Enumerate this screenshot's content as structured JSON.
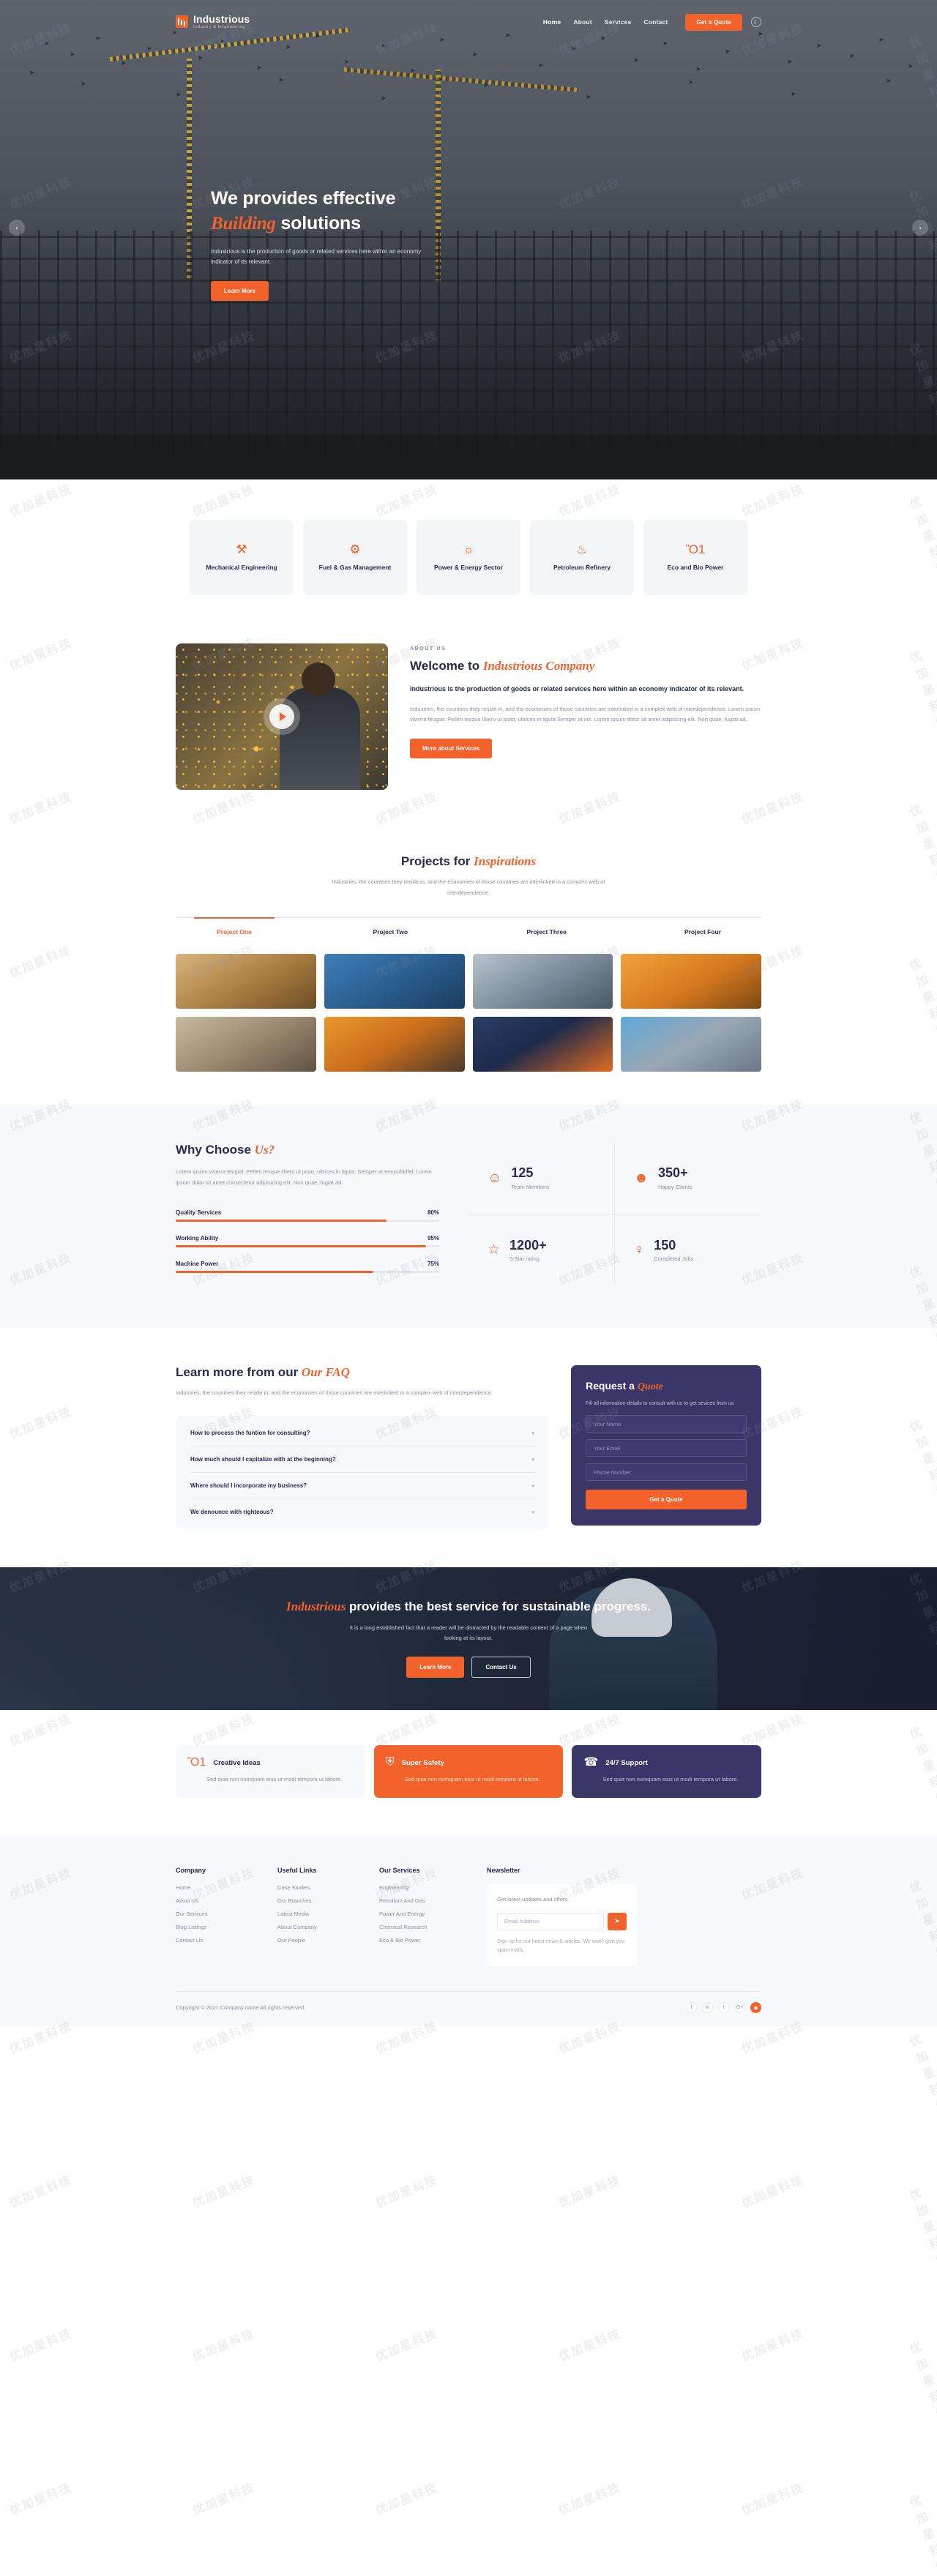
{
  "header": {
    "brand_name": "Industrious",
    "brand_sub": "Industry & Engineering",
    "nav": [
      {
        "label": "Home",
        "active": true
      },
      {
        "label": "About",
        "active": false
      },
      {
        "label": "Services",
        "active": false
      },
      {
        "label": "Contact",
        "active": false
      }
    ],
    "quote_label": "Get a Quote",
    "theme_icon": "moon-icon"
  },
  "hero": {
    "title_line1": "We provides effective",
    "title_em": "Building",
    "title_line2": " solutions",
    "paragraph": "Industrious is the production of goods or related services here within an economy indicator of its relevant.",
    "button": "Learn More",
    "prev_icon": "chevron-left-icon",
    "next_icon": "chevron-right-icon"
  },
  "services": [
    {
      "icon": "wrench-icon",
      "glyph": "⚒",
      "label": "Mechanical Engineering"
    },
    {
      "icon": "gears-icon",
      "glyph": "⚙",
      "label": "Fuel & Gas Management"
    },
    {
      "icon": "sun-energy-icon",
      "glyph": "☼",
      "label": "Power & Energy Sector"
    },
    {
      "icon": "flame-icon",
      "glyph": "♨",
      "label": "Petroleum Refinery"
    },
    {
      "icon": "bulb-icon",
      "glyph": "Ὂ1",
      "label": "Eco and Bio Power"
    }
  ],
  "about": {
    "eyebrow": "ABOUT US",
    "heading_plain": "Welcome to ",
    "heading_em": "Industrious Company",
    "lead": "Industrious is the production of goods or related services here within an economy indicator of its relevant.",
    "body": "Industries, the countries they reside in, and the economies of those countries are interlinked in a complex web of interdependence. Lorem ipsum viverra feugiat. Pellen tesque libero ut justo, ultrices in ligula Semper at init. Lorem ipsum dolor sit amet adipiscing elit. Non quae, fugiat ad.",
    "button": "More about Services",
    "play_icon": "play-icon"
  },
  "projects": {
    "heading_plain": "Projects for ",
    "heading_em": "Inspirations",
    "subtitle": "Industries, the countries they reside in, and the economies of those countries are interlinked in a complex web of interdependence.",
    "tabs": [
      {
        "label": "Project One",
        "active": true
      },
      {
        "label": "Project Two",
        "active": false
      },
      {
        "label": "Project Three",
        "active": false
      },
      {
        "label": "Project Four",
        "active": false
      }
    ]
  },
  "why": {
    "heading_plain": "Why Choose ",
    "heading_em": "Us?",
    "paragraph": "Lorem ipsum viverra feugiat. Pellen tesque libero ut justo, ultrices in ligula. Semper at tempufddfel. Lorem ipsum dolor sit amet consectetur adipisicing elit. Non quae, fugiat ad.",
    "bars": [
      {
        "label": "Quality Services",
        "value": "80%",
        "pct": 80
      },
      {
        "label": "Working Ability",
        "value": "95%",
        "pct": 95
      },
      {
        "label": "Machine Power",
        "value": "75%",
        "pct": 75
      }
    ],
    "stats": [
      {
        "icon": "user-icon",
        "glyph": "☺",
        "number": "125",
        "label": "Team Members"
      },
      {
        "icon": "smiley-icon",
        "glyph": "☻",
        "number": "350+",
        "label": "Happy Clients"
      },
      {
        "icon": "star-icon",
        "glyph": "☆",
        "number": "1200+",
        "label": "5 Star rating"
      },
      {
        "icon": "bulb-icon",
        "glyph": "♀",
        "number": "150",
        "label": "Completed Jobs"
      }
    ]
  },
  "faq": {
    "heading_plain": "Learn more from our ",
    "heading_em": "Our FAQ",
    "subtitle": "Industries, the countries they reside in, and the economies of those countries are interlinked in a complex web of interdependence.",
    "items": [
      "How to process the funtion for consulting?",
      "How much should I capitalize with at the beginning?",
      "Where should I incorporate my business?",
      "We denounce with righteous?"
    ],
    "chevron_icon": "chevron-down-icon"
  },
  "quote_form": {
    "heading_plain": "Request a ",
    "heading_em": "Quote",
    "paragraph": "Fill all information details to consult with us to get sevices from us",
    "fields": [
      {
        "name": "name-field",
        "placeholder": "Your Name"
      },
      {
        "name": "email-field",
        "placeholder": "Your Email"
      },
      {
        "name": "phone-field",
        "placeholder": "Phone Number"
      }
    ],
    "submit": "Get a Quote"
  },
  "cta": {
    "heading_em": "Industrious",
    "heading_plain": " provides the best service for sustainable progress.",
    "paragraph": "It is a long established fact that a reader will be distracted by the readable content of a page when looking at its layout.",
    "primary": "Learn More",
    "secondary": "Contact Us"
  },
  "features": [
    {
      "icon": "bulb-icon",
      "glyph": "Ὂ1",
      "title": "Creative Ideas",
      "desc": "Sed quia non numquam eius ut modi tempora ut labore.",
      "style": "light"
    },
    {
      "icon": "shield-icon",
      "glyph": "⛨",
      "title": "Super Safety",
      "desc": "Sed quia non numquam eius ut modi tempora ut labore.",
      "style": "orange"
    },
    {
      "icon": "headset-icon",
      "glyph": "☎",
      "title": "24/7 Support",
      "desc": "Sed quia non numquam eius ut modi tempora ut labore.",
      "style": "purple"
    }
  ],
  "footer": {
    "columns": [
      {
        "title": "Company",
        "links": [
          "Home",
          "About Us",
          "Our Services",
          "Blog Listings",
          "Contact Us"
        ]
      },
      {
        "title": "Useful Links",
        "links": [
          "Case Studies",
          "Our Branches",
          "Latest Media",
          "About Company",
          "Our People"
        ]
      },
      {
        "title": "Our Services",
        "links": [
          "Engineering",
          "Petrolium And Gas",
          "Power And Energy",
          "Chemical Research",
          "Eco & Bio Power"
        ]
      }
    ],
    "newsletter": {
      "title": "Newsletter",
      "text": "Get latest updates and offers.",
      "placeholder": "Email Address",
      "send_icon": "send-icon",
      "note": "Sign up for our latest news & articles. We won't give you spam mails."
    },
    "copyright": "Copyright © 2021 Company name All rights reserved.",
    "socials": [
      {
        "icon": "facebook-icon",
        "glyph": "f",
        "active": false
      },
      {
        "icon": "linkedin-icon",
        "glyph": "in",
        "active": false
      },
      {
        "icon": "twitter-icon",
        "glyph": "t",
        "active": false
      },
      {
        "icon": "google-plus-icon",
        "glyph": "G+",
        "active": false
      },
      {
        "icon": "instagram-icon",
        "glyph": "◉",
        "active": true
      }
    ]
  },
  "colors": {
    "accent": "#f2622a",
    "dark": "#272a4d",
    "purple": "#3b3668",
    "muted": "#8a8fa3",
    "panel": "#f7f9fc"
  },
  "watermark": "优加星科技"
}
